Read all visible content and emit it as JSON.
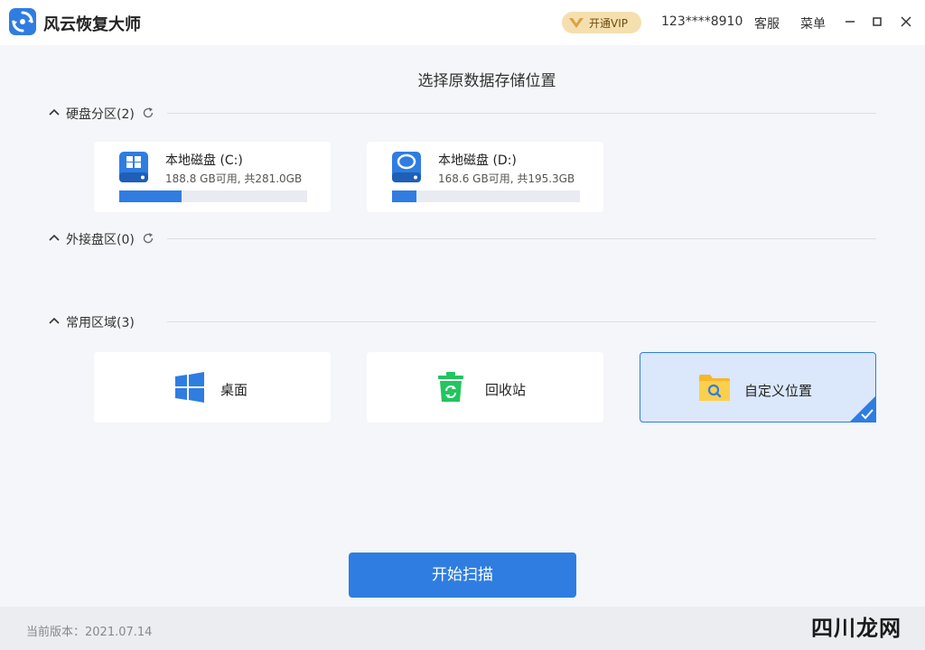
{
  "app": {
    "title": "风云恢复大师",
    "vip_label": "开通VIP",
    "user_id": "123****8910",
    "service_label": "客服",
    "menu_label": "菜单"
  },
  "page_title": "选择原数据存储位置",
  "sections": {
    "disk": {
      "label": "硬盘分区(2)"
    },
    "external": {
      "label": "外接盘区(0)"
    },
    "common": {
      "label": "常用区域(3)"
    }
  },
  "drives": [
    {
      "name": "本地磁盘 (C:)",
      "space": "188.8 GB可用, 共281.0GB",
      "used_fraction": 0.33
    },
    {
      "name": "本地磁盘 (D:)",
      "space": "168.6 GB可用, 共195.3GB",
      "used_fraction": 0.13
    }
  ],
  "areas": [
    {
      "label": "桌面",
      "icon": "windows-icon"
    },
    {
      "label": "回收站",
      "icon": "recycle-bin-icon"
    },
    {
      "label": "自定义位置",
      "icon": "folder-search-icon",
      "selected": true
    }
  ],
  "scan_button": "开始扫描",
  "footer": {
    "version": "当前版本：2021.07.14"
  },
  "watermark": "四川龙网",
  "colors": {
    "accent": "#2f7de1",
    "vip": "#f6dfae",
    "selected_bg": "#dbe7fb",
    "recycle": "#22c55e",
    "folder": "#f8b62b"
  }
}
